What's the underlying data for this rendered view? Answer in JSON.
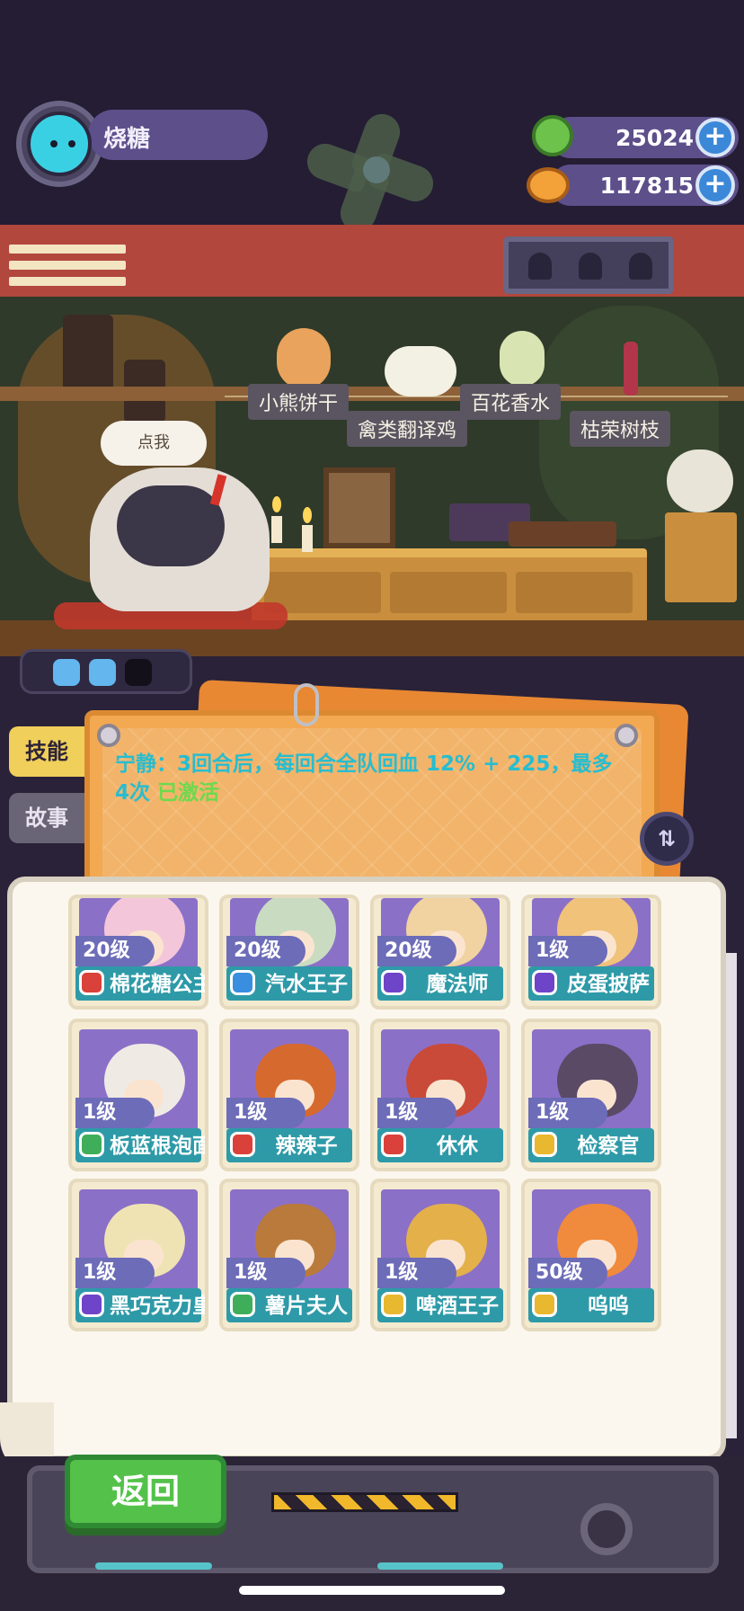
{
  "player": {
    "name": "烧糖",
    "avatar_icon": "cat-face-icon"
  },
  "currencies": [
    {
      "icon": "green-coin-icon",
      "value": "25024",
      "add": "+"
    },
    {
      "icon": "planet-coin-icon",
      "value": "117815",
      "add": "+"
    }
  ],
  "shop": {
    "shelf_labels": [
      "小熊饼干",
      "禽类翻译鸡",
      "百花香水",
      "枯荣树枝"
    ],
    "speech_bubble": "点我"
  },
  "tokens": {
    "filled": 2,
    "total": 3
  },
  "tabs": {
    "skill": "技能",
    "story": "故事"
  },
  "skill": {
    "text": "宁静：3回合后，每回合全队回血 12% + 225，最多4次",
    "status": "已激活"
  },
  "characters": [
    {
      "level": "20级",
      "name": "棉花糖公主",
      "badge_color": "#d9413a",
      "portrait": "#f3c7d9"
    },
    {
      "level": "20级",
      "name": "汽水王子",
      "badge_color": "#3a8ee0",
      "portrait": "#c9dcc2"
    },
    {
      "level": "20级",
      "name": "魔法师",
      "badge_color": "#6e44c8",
      "portrait": "#f0d3a0"
    },
    {
      "level": "1级",
      "name": "皮蛋披萨",
      "badge_color": "#6e44c8",
      "portrait": "#f0c27a"
    },
    {
      "level": "1级",
      "name": "板蓝根泡面",
      "badge_color": "#3fae5a",
      "portrait": "#efeae4"
    },
    {
      "level": "1级",
      "name": "辣辣子",
      "badge_color": "#d9413a",
      "portrait": "#d66a2e"
    },
    {
      "level": "1级",
      "name": "休休",
      "badge_color": "#d9413a",
      "portrait": "#c94a38"
    },
    {
      "level": "1级",
      "name": "检察官",
      "badge_color": "#e8b830",
      "portrait": "#5a4a66"
    },
    {
      "level": "1级",
      "name": "黑巧克力皇后",
      "badge_color": "#6e44c8",
      "portrait": "#efe3b4"
    },
    {
      "level": "1级",
      "name": "薯片夫人",
      "badge_color": "#3fae5a",
      "portrait": "#b97a3c"
    },
    {
      "level": "1级",
      "name": "啤酒王子",
      "badge_color": "#e8b830",
      "portrait": "#e3b04a"
    },
    {
      "level": "50级",
      "name": "呜呜",
      "badge_color": "#e8b830",
      "portrait": "#f08a3c"
    }
  ],
  "buttons": {
    "back": "返回",
    "swap": "⇅"
  }
}
